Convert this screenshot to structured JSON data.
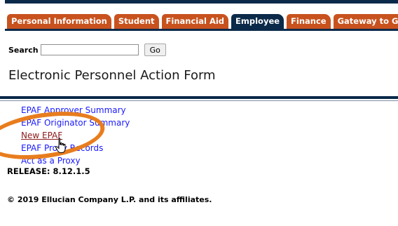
{
  "nav": {
    "tabs": [
      {
        "label": "Personal Information",
        "active": false
      },
      {
        "label": "Student",
        "active": false
      },
      {
        "label": "Financial Aid",
        "active": false
      },
      {
        "label": "Employee",
        "active": true
      },
      {
        "label": "Finance",
        "active": false
      },
      {
        "label": "Gateway to Grades",
        "active": false
      }
    ]
  },
  "search": {
    "label": "Search",
    "value": "",
    "button_label": "Go"
  },
  "main": {
    "title": "Electronic Personnel Action Form",
    "links": [
      {
        "label": "EPAF Approver Summary",
        "visited": false
      },
      {
        "label": "EPAF Originator Summary",
        "visited": false
      },
      {
        "label": "New EPAF",
        "visited": true
      },
      {
        "label": "EPAF Proxy Records",
        "visited": false
      },
      {
        "label": "Act as a Proxy",
        "visited": false
      }
    ]
  },
  "footer": {
    "release": "RELEASE: 8.12.1.5",
    "copyright": "© 2019 Ellucian Company L.P. and its affiliates."
  },
  "colors": {
    "tab": "#c8521e",
    "tab_active": "#0b2a4a",
    "link": "#1a1aff",
    "link_visited": "#8b1a1a",
    "annotation": "#e87d1e"
  },
  "icons": {
    "cursor": "hand-pointer-icon"
  }
}
